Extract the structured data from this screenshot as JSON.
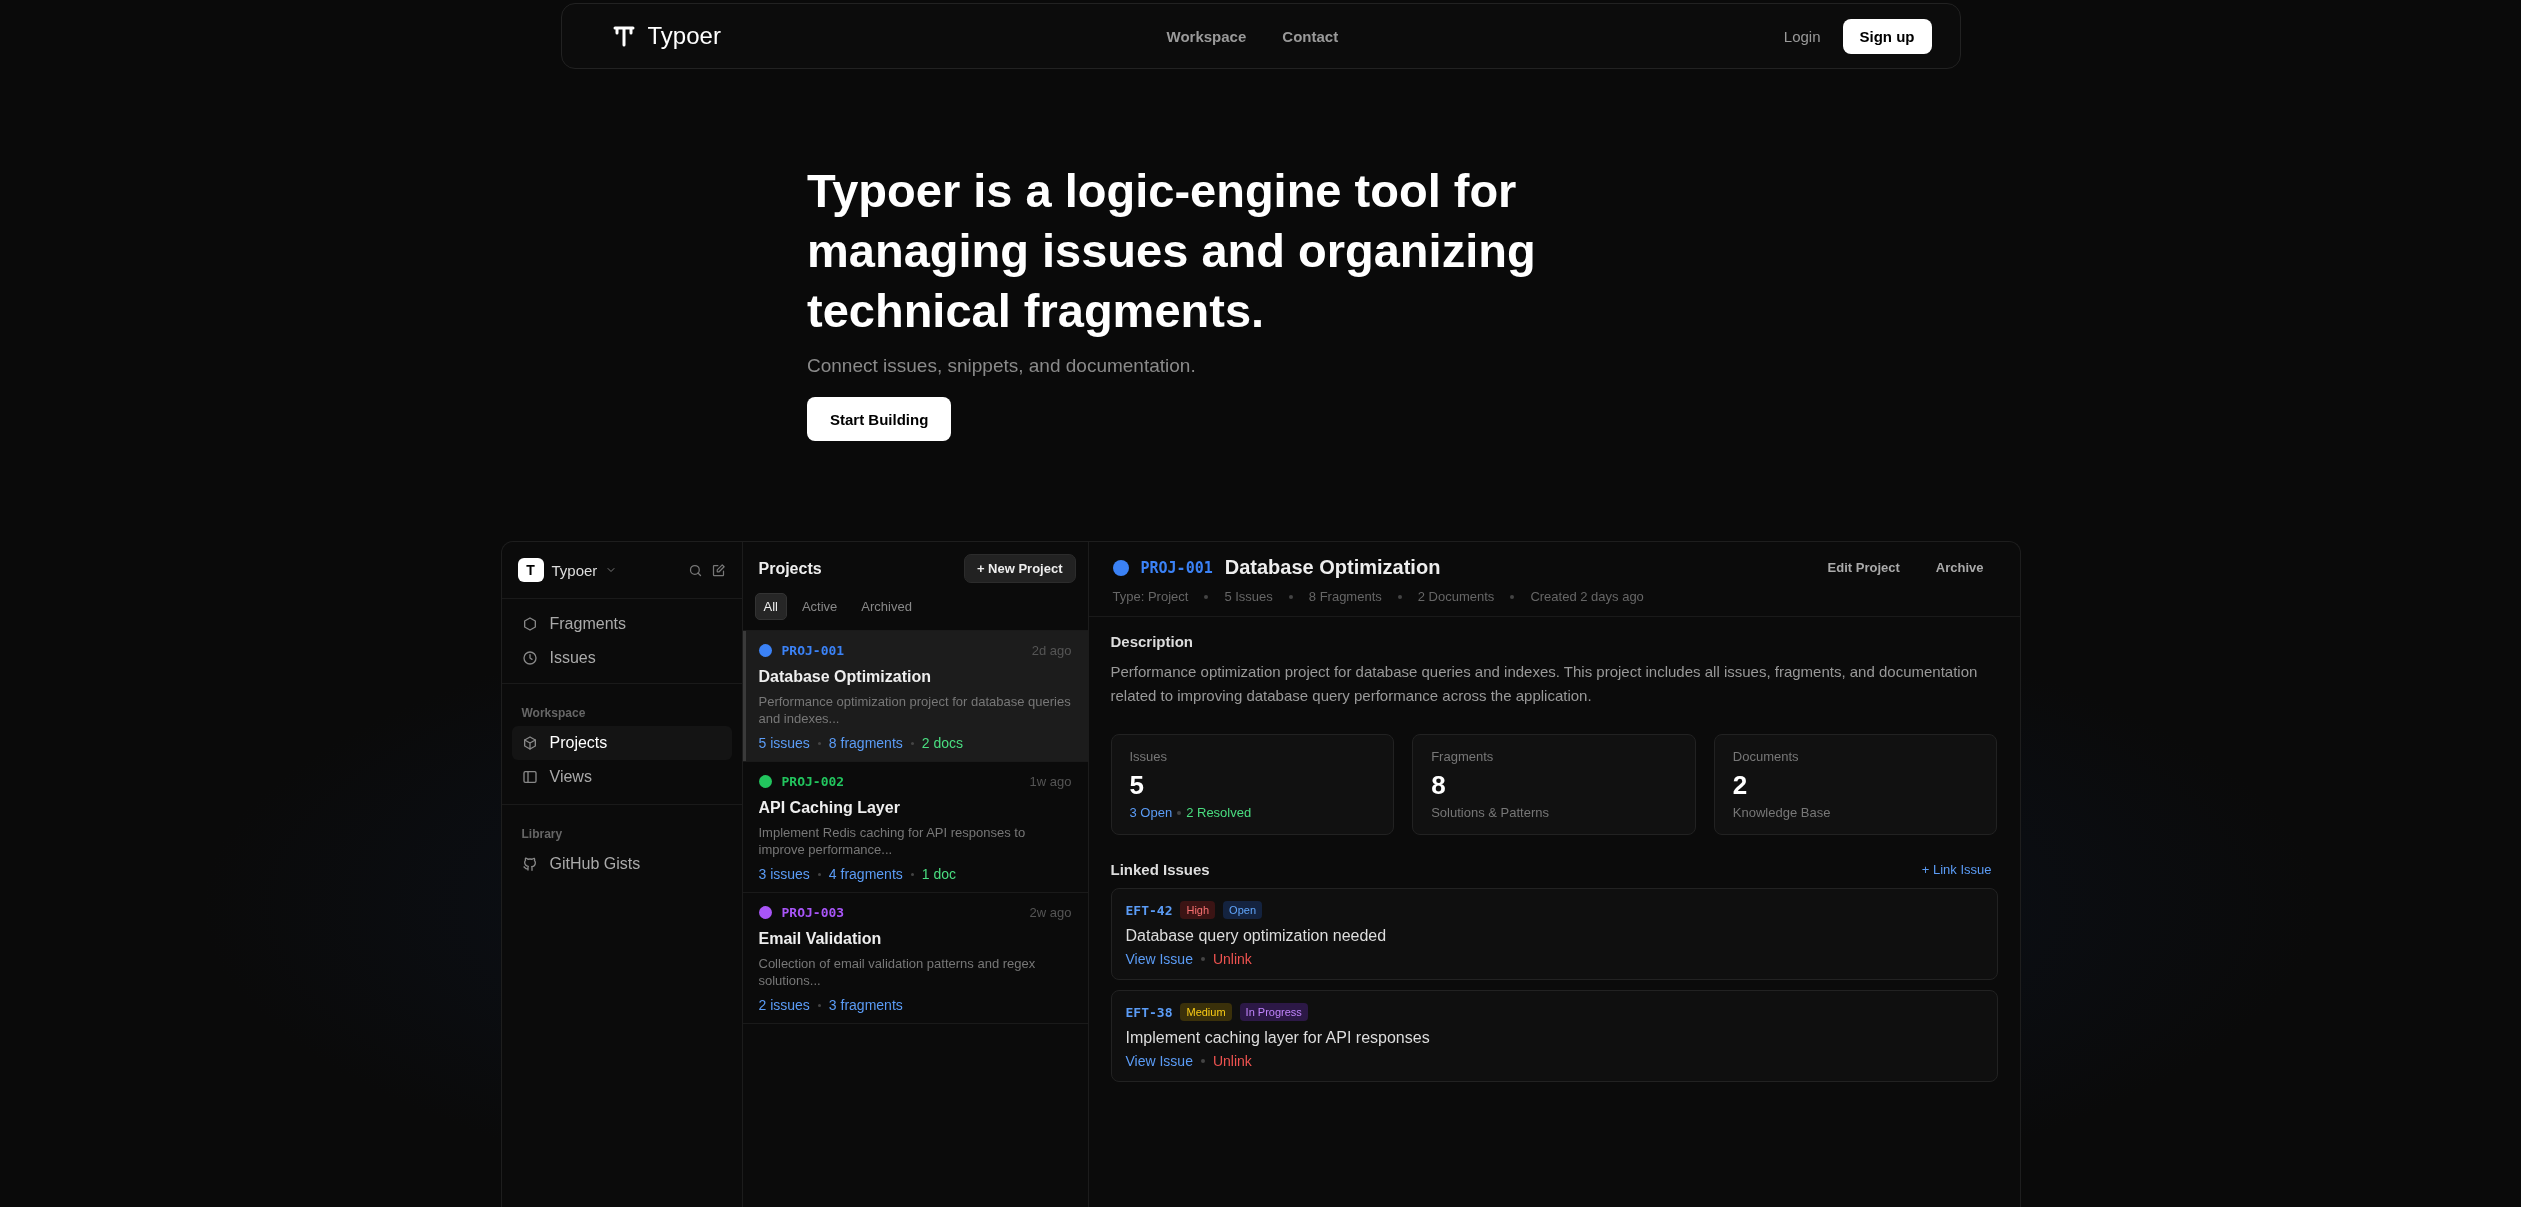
{
  "nav": {
    "brand": "Typoer",
    "links": [
      "Workspace",
      "Contact"
    ],
    "login": "Login",
    "signup": "Sign up"
  },
  "hero": {
    "title": "Typoer is a logic-engine tool for managing issues and organizing technical fragments.",
    "subtitle": "Connect issues, snippets, and documentation.",
    "cta": "Start Building"
  },
  "sidebar": {
    "logo_letter": "T",
    "workspace_name": "Typoer",
    "top_items": [
      {
        "label": "Fragments",
        "selected": false
      },
      {
        "label": "Issues",
        "selected": false
      }
    ],
    "sections": [
      {
        "heading": "Workspace",
        "items": [
          {
            "label": "Projects",
            "selected": true
          },
          {
            "label": "Views",
            "selected": false
          }
        ]
      },
      {
        "heading": "Library",
        "items": [
          {
            "label": "GitHub Gists",
            "selected": false
          }
        ]
      }
    ]
  },
  "projects": {
    "title": "Projects",
    "new_button": "+ New Project",
    "filters": [
      {
        "label": "All",
        "selected": true
      },
      {
        "label": "Active",
        "selected": false
      },
      {
        "label": "Archived",
        "selected": false
      }
    ],
    "items": [
      {
        "id": "PROJ-001",
        "color": "#3b82f6",
        "time": "2d ago",
        "title": "Database Optimization",
        "description": "Performance optimization project for database queries and indexes...",
        "selected": true,
        "stats": [
          {
            "text": "5 issues",
            "kind": "link"
          },
          {
            "text": "8 fragments",
            "kind": "link"
          },
          {
            "text": "2 docs",
            "kind": "doc"
          }
        ]
      },
      {
        "id": "PROJ-002",
        "color": "#22c55e",
        "time": "1w ago",
        "title": "API Caching Layer",
        "description": "Implement Redis caching for API responses to improve performance...",
        "selected": false,
        "stats": [
          {
            "text": "3 issues",
            "kind": "link"
          },
          {
            "text": "4 fragments",
            "kind": "link"
          },
          {
            "text": "1 doc",
            "kind": "doc"
          }
        ]
      },
      {
        "id": "PROJ-003",
        "color": "#a855f7",
        "time": "2w ago",
        "title": "Email Validation",
        "description": "Collection of email validation patterns and regex solutions...",
        "selected": false,
        "stats": [
          {
            "text": "2 issues",
            "kind": "link"
          },
          {
            "text": "3 fragments",
            "kind": "link"
          }
        ]
      }
    ]
  },
  "detail": {
    "color": "#3b82f6",
    "id": "PROJ-001",
    "title": "Database Optimization",
    "actions": [
      "Edit Project",
      "Archive"
    ],
    "meta": [
      "Type: Project",
      "5 Issues",
      "8 Fragments",
      "2 Documents",
      "Created 2 days ago"
    ],
    "description_heading": "Description",
    "description": "Performance optimization project for database queries and indexes. This project includes all issues, fragments, and documentation related to improving database query performance across the application.",
    "stat_cards": [
      {
        "label": "Issues",
        "value": "5",
        "notes": [
          {
            "text": "3 Open",
            "kind": "open"
          },
          {
            "text": "2 Resolved",
            "kind": "resolved"
          }
        ]
      },
      {
        "label": "Fragments",
        "value": "8",
        "notes": [
          {
            "text": "Solutions & Patterns",
            "kind": "plain"
          }
        ]
      },
      {
        "label": "Documents",
        "value": "2",
        "notes": [
          {
            "text": "Knowledge Base",
            "kind": "plain"
          }
        ]
      }
    ],
    "linked_heading": "Linked Issues",
    "link_action": "+ Link Issue",
    "issues": [
      {
        "id": "EFT-42",
        "priority": {
          "label": "High",
          "kind": "high"
        },
        "status": {
          "label": "Open",
          "kind": "open"
        },
        "title": "Database query optimization needed",
        "actions": [
          {
            "label": "View Issue",
            "kind": "view"
          },
          {
            "label": "Unlink",
            "kind": "unlink"
          }
        ]
      },
      {
        "id": "EFT-38",
        "priority": {
          "label": "Medium",
          "kind": "medium"
        },
        "status": {
          "label": "In Progress",
          "kind": "progress"
        },
        "title": "Implement caching layer for API responses",
        "actions": [
          {
            "label": "View Issue",
            "kind": "view"
          },
          {
            "label": "Unlink",
            "kind": "unlink"
          }
        ]
      }
    ]
  }
}
